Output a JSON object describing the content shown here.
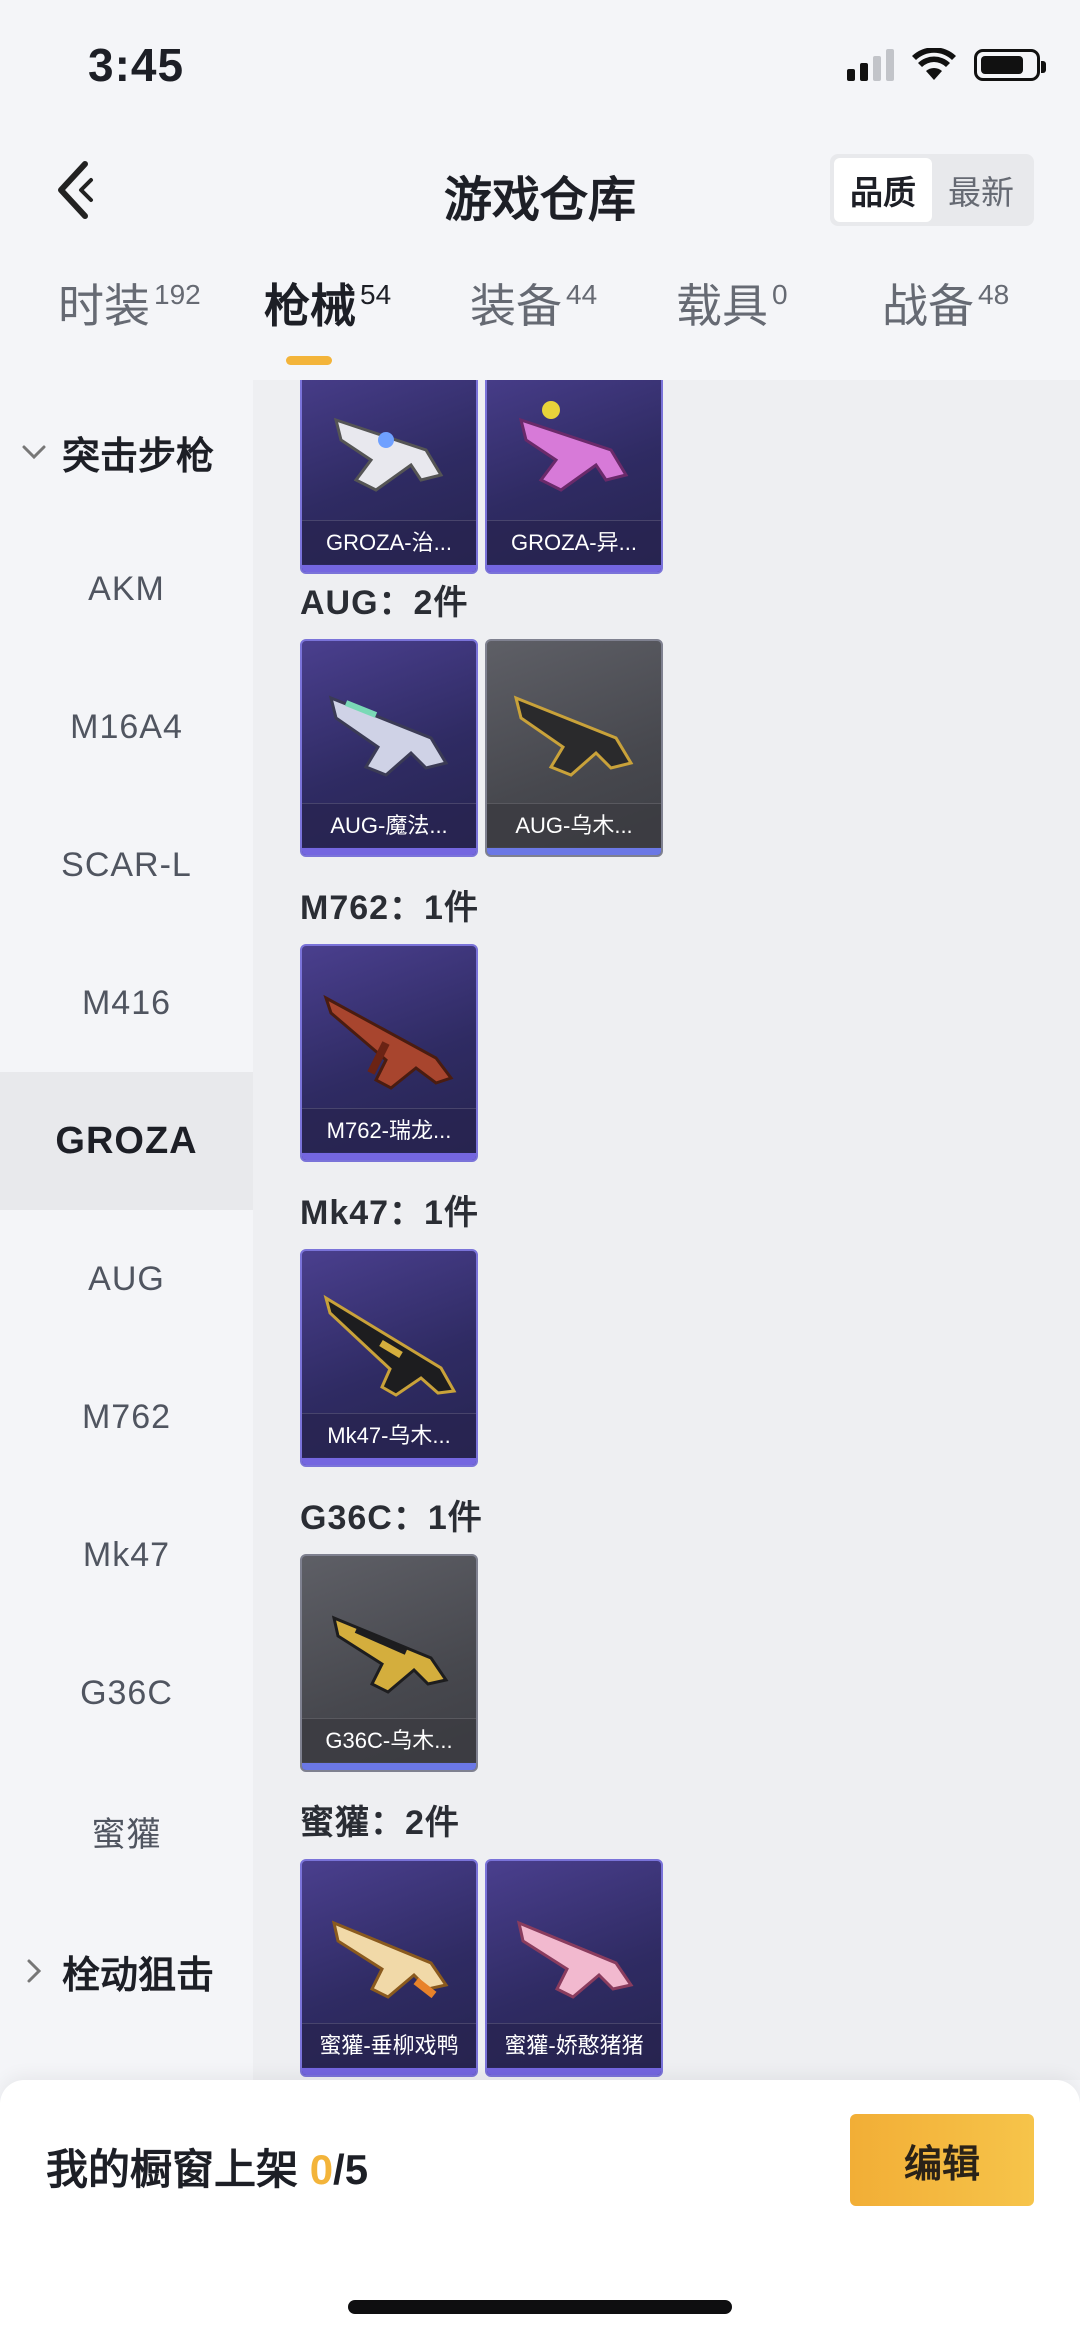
{
  "status": {
    "time": "3:45",
    "icons": [
      "cellular-signal-icon",
      "wifi-icon",
      "battery-icon"
    ]
  },
  "header": {
    "title": "游戏仓库",
    "sort_options": [
      "品质",
      "最新"
    ],
    "sort_active": "品质"
  },
  "tabs": [
    {
      "label": "时装",
      "count": "192"
    },
    {
      "label": "枪械",
      "count": "54",
      "active": true
    },
    {
      "label": "装备",
      "count": "44"
    },
    {
      "label": "载具",
      "count": "0"
    },
    {
      "label": "战备",
      "count": "48"
    }
  ],
  "sidebar": {
    "group_assault": "突击步枪",
    "items": [
      "AKM",
      "M16A4",
      "SCAR-L",
      "M416",
      "GROZA",
      "AUG",
      "M762",
      "Mk47",
      "G36C",
      "蜜獾"
    ],
    "active_item": "GROZA",
    "group_sniper": "栓动狙击"
  },
  "content": {
    "groza_cards": [
      "GROZA-治...",
      "GROZA-异..."
    ],
    "aug_title": "AUG：2件",
    "aug_cards": [
      "AUG-魔法...",
      "AUG-乌木..."
    ],
    "m762_title": "M762：1件",
    "m762_cards": [
      "M762-瑞龙..."
    ],
    "mk47_title": "Mk47：1件",
    "mk47_cards": [
      "Mk47-乌木..."
    ],
    "g36c_title": "G36C：1件",
    "g36c_cards": [
      "G36C-乌木..."
    ],
    "honey_title": "蜜獾：2件",
    "honey_cards": [
      "蜜獾-垂柳戏鸭",
      "蜜獾-娇憨猪猪"
    ]
  },
  "bottom": {
    "showcase_label": "我的橱窗上架",
    "showcase_count": "0",
    "showcase_total": "/5",
    "edit_label": "编辑"
  },
  "colors": {
    "accent": "#f3b43a",
    "card_purple": "#2f2b63",
    "card_gray": "#47484e"
  }
}
